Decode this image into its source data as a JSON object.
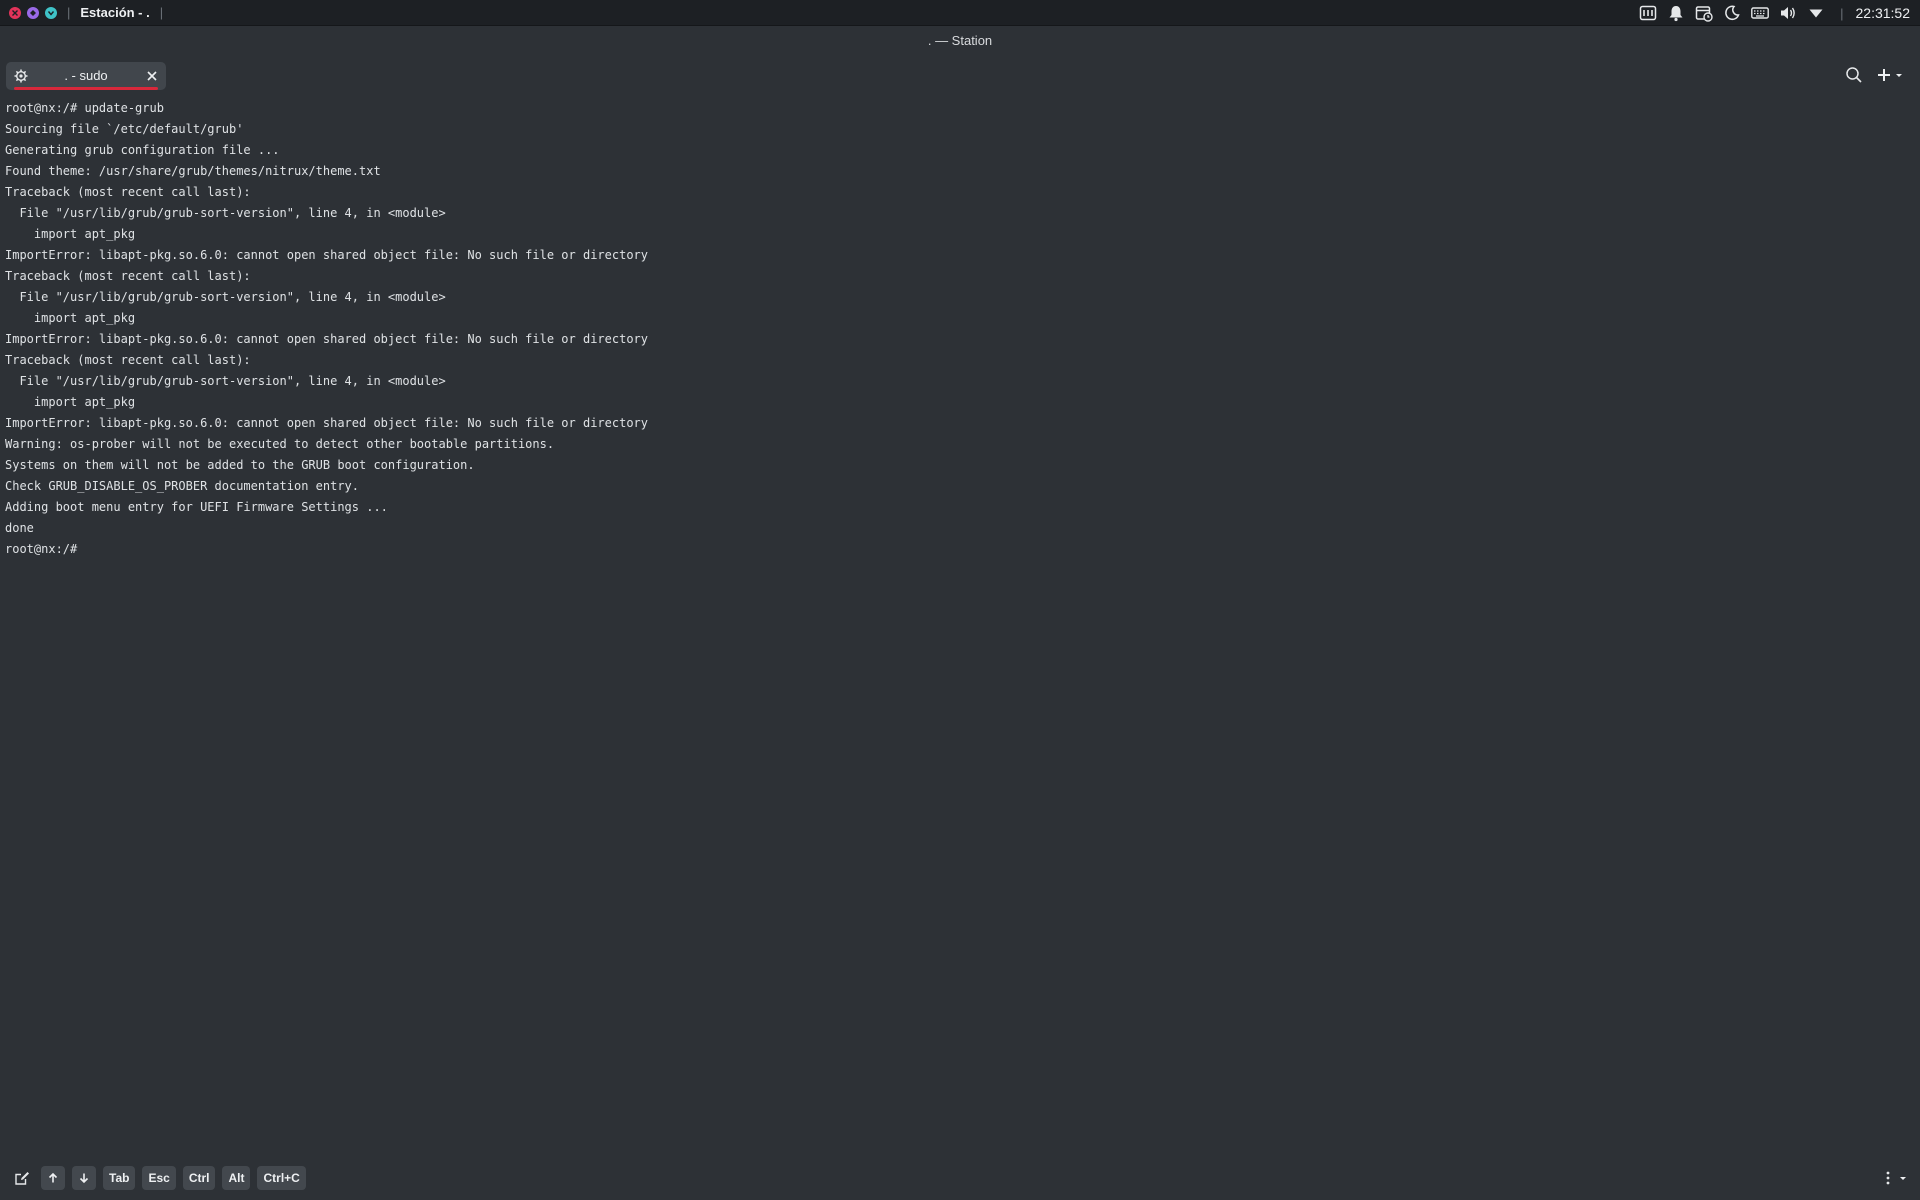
{
  "topbar": {
    "app_title": "Estación - .",
    "clock": "22:31:52",
    "tray_icons": [
      "keyboard-layout-icon",
      "notifications-icon",
      "calendar-icon",
      "night-mode-icon",
      "virtual-keyboard-icon",
      "volume-icon",
      "network-icon"
    ]
  },
  "window": {
    "title": ". — Station"
  },
  "tabs": [
    {
      "label": ". - sudo",
      "active": true
    }
  ],
  "terminal": {
    "lines": [
      "root@nx:/# update-grub",
      "Sourcing file `/etc/default/grub'",
      "Generating grub configuration file ...",
      "Found theme: /usr/share/grub/themes/nitrux/theme.txt",
      "Traceback (most recent call last):",
      "  File \"/usr/lib/grub/grub-sort-version\", line 4, in <module>",
      "    import apt_pkg",
      "ImportError: libapt-pkg.so.6.0: cannot open shared object file: No such file or directory",
      "Traceback (most recent call last):",
      "  File \"/usr/lib/grub/grub-sort-version\", line 4, in <module>",
      "    import apt_pkg",
      "ImportError: libapt-pkg.so.6.0: cannot open shared object file: No such file or directory",
      "Traceback (most recent call last):",
      "  File \"/usr/lib/grub/grub-sort-version\", line 4, in <module>",
      "    import apt_pkg",
      "ImportError: libapt-pkg.so.6.0: cannot open shared object file: No such file or directory",
      "Warning: os-prober will not be executed to detect other bootable partitions.",
      "Systems on them will not be added to the GRUB boot configuration.",
      "Check GRUB_DISABLE_OS_PROBER documentation entry.",
      "Adding boot menu entry for UEFI Firmware Settings ...",
      "done",
      "root@nx:/#"
    ]
  },
  "keybar": {
    "keys": [
      "Tab",
      "Esc",
      "Ctrl",
      "Alt",
      "Ctrl+C"
    ]
  },
  "colors": {
    "background": "#2d3136",
    "panel": "#1d2024",
    "tab": "#41464c",
    "accent": "#d8283b"
  }
}
